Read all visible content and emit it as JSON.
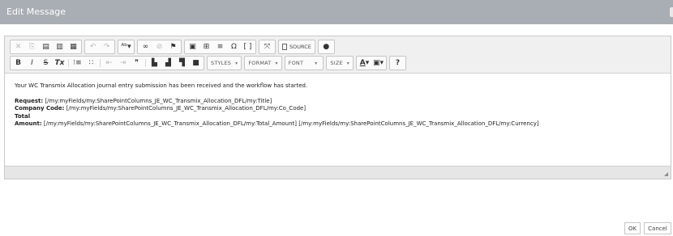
{
  "dialog": {
    "title": "Edit Message"
  },
  "toolbar": {
    "row1": {
      "clipboard": [
        "cut-icon",
        "copy-icon",
        "paste-icon",
        "paste-text-icon",
        "paste-word-icon"
      ],
      "history": [
        "undo-icon",
        "redo-icon"
      ],
      "spellcheck": "spellcheck-icon",
      "links": [
        "link-icon",
        "unlink-icon",
        "anchor-icon"
      ],
      "insert": [
        "image-icon",
        "table-icon",
        "horizontal-rule-icon",
        "special-char-icon",
        "iframe-icon"
      ],
      "maximize": "maximize-icon",
      "source_label": "SOURCE",
      "about": "about-icon"
    },
    "row2": {
      "basic": [
        "B",
        "I",
        "S",
        "Tx"
      ],
      "styles_label": "STYLES",
      "format_label": "FORMAT",
      "font_label": "FONT",
      "size_label": "SIZE",
      "help": "?"
    }
  },
  "content": {
    "intro": "Your WC Transmix Allocation journal entry submission has been received and the workflow has started.",
    "request_label": "Request:",
    "request_value": "[/my:myFields/my:SharePointColumns_JE_WC_Transmix_Allocation_DFL/my:Title]",
    "company_label": "Company Code:",
    "company_value": "[/my:myFields/my:SharePointColumns_JE_WC_Transmix_Allocation_DFL/my:Co_Code]",
    "total_label": "Total",
    "amount_label": "Amount:",
    "amount_value": "[/my:myFields/my:SharePointColumns_JE_WC_Transmix_Allocation_DFL/my:Total_Amount] [/my:myFields/my:SharePointColumns_JE_WC_Transmix_Allocation_DFL/my:Currency]"
  },
  "buttons": {
    "ok": "OK",
    "cancel": "Cancel"
  },
  "colors": {
    "header": "#a9adb4",
    "toolbar": "#f0f0f0",
    "statusbar": "#e6e6e6"
  }
}
